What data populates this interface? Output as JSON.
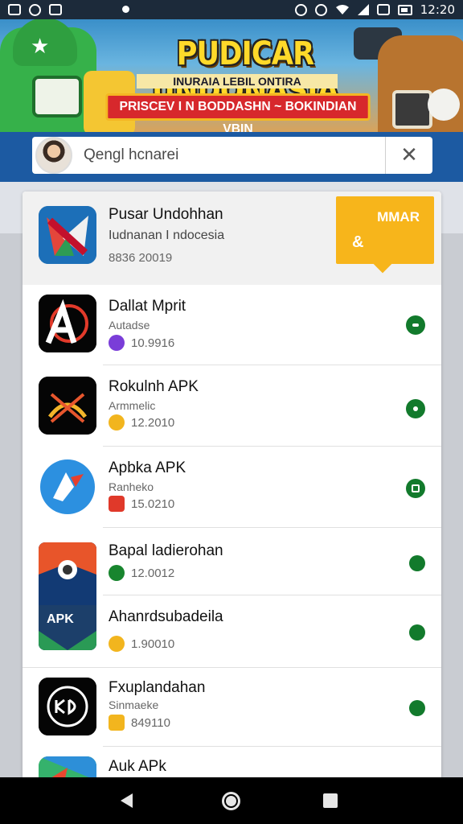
{
  "status_bar": {
    "time": "12:20"
  },
  "banner": {
    "title": "PUDICAR UNDONASIA",
    "subtitle": "INURAIA LEBIL ONTIRA",
    "ribbon": "PRISCEV I N BODDASHN ~ BOKINDIAN VBIN"
  },
  "search": {
    "query": "Qengl hcnarei",
    "clear_icon": "close-icon"
  },
  "featured": {
    "name": "Pusar Undohhan",
    "subtitle": "Iudnanan I ndocesia",
    "meta": "8836 20019",
    "button_label": "MMAR",
    "button_symbol": "&",
    "accent": "#f7b51b"
  },
  "apps": [
    {
      "name": "Dallat Mprit",
      "sub": "Autadse",
      "meta": "10.9916"
    },
    {
      "name": "Rokulnh APK",
      "sub": "Armmelic",
      "meta": "12.2010"
    },
    {
      "name": "Apbka APK",
      "sub": "Ranheko",
      "meta": "15.0210"
    },
    {
      "name": "Bapal ladierohan",
      "sub": "",
      "meta": "12.0012"
    },
    {
      "name": "Ahanrdsubadeila",
      "sub": "",
      "meta": "1.90010"
    },
    {
      "name": "Fxuplandahan",
      "sub": "Sinmaeke",
      "meta": "849110"
    },
    {
      "name": "Auk APk",
      "sub": "",
      "meta": ""
    }
  ],
  "shared_icon_text": "APK",
  "status_color": "#127a2c"
}
